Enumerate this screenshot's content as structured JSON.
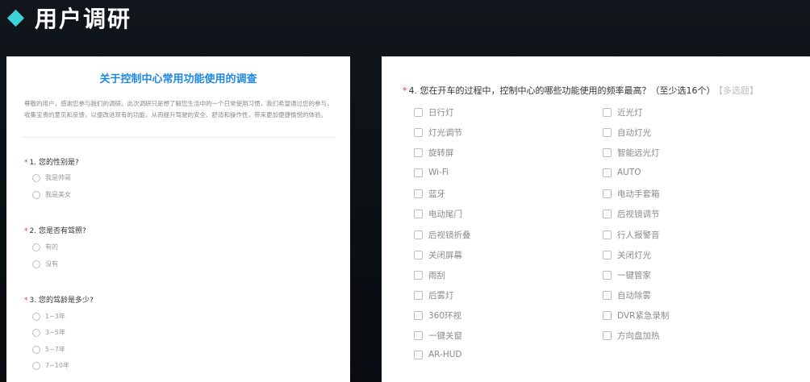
{
  "header": {
    "title": "用户调研"
  },
  "survey": {
    "title": "关于控制中心常用功能使用的调查",
    "intro": "尊敬的用户，感谢您参与我们的调研。此次调研只是想了解您生活中的一个日常使用习惯，我们希望通过您的参与，收集宝贵的意见和反馈，以便改进现有的功能，从而提升驾驶的安全、舒适和操作性，带来更加便捷愉悦的体验。",
    "q1": {
      "star": "*",
      "label": "1. 您的性别是?",
      "options": [
        "我是帅哥",
        "我是美女"
      ]
    },
    "q2": {
      "star": "*",
      "label": "2. 您是否有驾照?",
      "options": [
        "有的",
        "没有"
      ]
    },
    "q3": {
      "star": "*",
      "label": "3. 您的驾龄是多少?",
      "options": [
        "1~3年",
        "3~5年",
        "5~7年",
        "7~10年"
      ]
    },
    "q4": {
      "star": "*",
      "label": "4. 您在开车的过程中，控制中心的哪些功能使用的频率最高？（至少选16个）",
      "hint": "【多选题】",
      "left_options": [
        "日行灯",
        "灯光调节",
        "旋转屏",
        "Wi-Fi",
        "蓝牙",
        "电动尾门",
        "后视镜折叠",
        "关闭屏幕",
        "雨刮",
        "后雾灯",
        "360环视",
        "一键关窗",
        "AR-HUD"
      ],
      "right_options": [
        "近光灯",
        "自动灯光",
        "智能远光灯",
        "AUTO",
        "电动手套箱",
        "后视镜调节",
        "行人报警音",
        "关闭灯光",
        "一键管家",
        "自动除雾",
        "DVR紧急录制",
        "方向盘加热"
      ]
    }
  }
}
